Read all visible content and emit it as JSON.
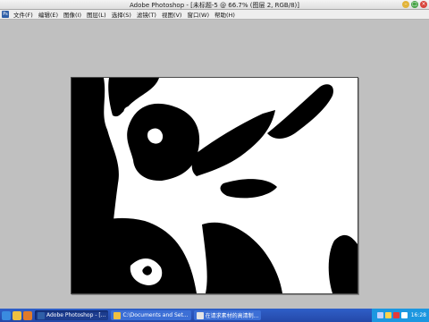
{
  "window": {
    "title": "Adobe Photoshop - [未标题-5 @ 66.7% (图层 2, RGB/8)]",
    "controls": {
      "minimize": "–",
      "maximize": "□",
      "close": "×"
    }
  },
  "menubar": {
    "app_icon_label": "Ps",
    "items": [
      "文件(F)",
      "编辑(E)",
      "图像(I)",
      "图层(L)",
      "选择(S)",
      "滤镜(T)",
      "视图(V)",
      "窗口(W)",
      "帮助(H)"
    ]
  },
  "taskbar": {
    "quick_launch": [
      "ie-icon",
      "folder-icon",
      "media-icon"
    ],
    "tasks": [
      {
        "label": "Adobe Photoshop - [...",
        "icon": "photoshop-icon",
        "active": true
      },
      {
        "label": "C:\\Documents and Set...",
        "icon": "folder-icon",
        "active": false
      },
      {
        "label": "在请求素材的高清制...",
        "icon": "browser-icon",
        "active": false
      }
    ],
    "tray_icons": [
      "network-icon",
      "volume-icon",
      "antivirus-icon",
      "ime-icon"
    ],
    "clock": "16:28"
  },
  "colors": {
    "taskbar": "#2448a8",
    "tray": "#1c97e0",
    "workspace": "#c0c0c0"
  }
}
